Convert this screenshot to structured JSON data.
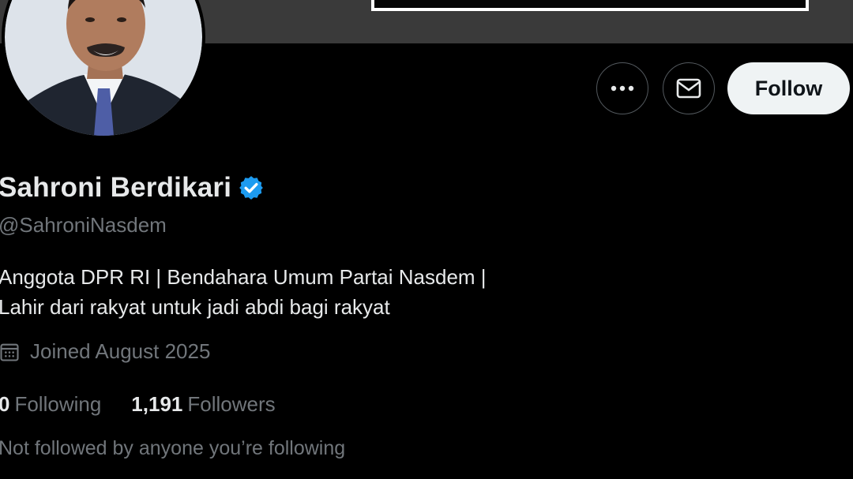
{
  "profile": {
    "display_name": "Sahroni Berdikari",
    "verified": true,
    "handle": "@SahroniNasdem",
    "bio_lines": [
      "Anggota DPR RI | Bendahara Umum Partai Nasdem |",
      "Lahir dari rakyat untuk jadi abdi bagi rakyat"
    ],
    "joined": "Joined August 2025",
    "following_count": "0",
    "following_label": "Following",
    "followers_count": "1,191",
    "followers_label": "Followers",
    "social_context": "Not followed by anyone you’re following"
  },
  "actions": {
    "more_icon": "more-horizontal-icon",
    "message_icon": "envelope-icon",
    "follow_label": "Follow"
  },
  "icons": {
    "verified": "verified-badge-icon",
    "calendar": "calendar-icon"
  },
  "colors": {
    "background": "#000000",
    "primary_text": "#e7e9ea",
    "secondary_text": "#71767b",
    "verified_blue": "#1d9bf0",
    "follow_button_bg": "#eff3f4",
    "banner": "#3a3a3a"
  }
}
